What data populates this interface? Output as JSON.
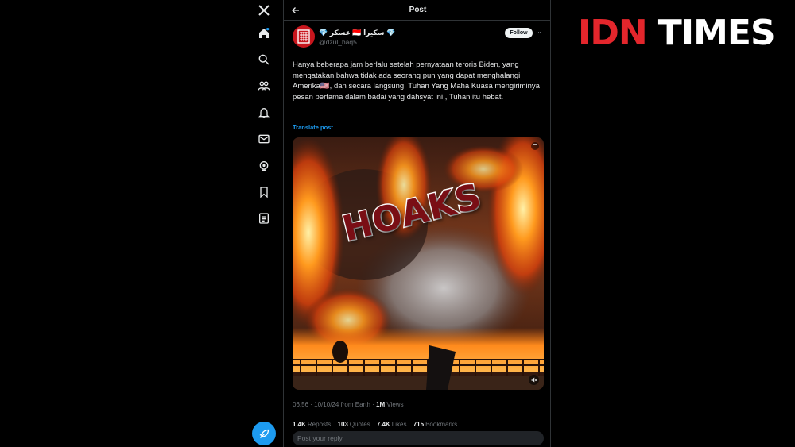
{
  "sidebar": {
    "icons": [
      "x-logo-icon",
      "home-icon",
      "search-icon",
      "communities-icon",
      "notifications-icon",
      "messages-icon",
      "grok-icon",
      "bookmarks-icon",
      "lists-icon"
    ],
    "post_button_icon": "feather-icon",
    "accent": "#1d9bf0"
  },
  "header": {
    "title": "Post",
    "back_icon": "arrow-left-icon"
  },
  "author": {
    "display_name": "💎 عسكر 🇮🇩 سكيرا 💎",
    "handle": "@dzul_haq5",
    "follow_label": "Follow",
    "more_label": "···"
  },
  "post": {
    "text": "Hanya beberapa jam berlalu setelah pernyataan teroris Biden, yang mengatakan bahwa tidak ada seorang pun yang dapat menghalangi Amerika🇺🇸, dan secara langsung, Tuhan Yang Maha Kuasa mengiriminya pesan pertama dalam badai yang dahsyat ini , Tuhan itu hebat.",
    "translate_label": "Translate post",
    "media_overlay_text": "HOAKS"
  },
  "meta": {
    "time": "06.56",
    "date": "10/10/24",
    "location": "from Earth",
    "views_value": "1M",
    "views_label": "Views",
    "sep": "·"
  },
  "stats": [
    {
      "value": "1.4K",
      "label": "Reposts"
    },
    {
      "value": "103",
      "label": "Quotes"
    },
    {
      "value": "7.4K",
      "label": "Likes"
    },
    {
      "value": "715",
      "label": "Bookmarks"
    }
  ],
  "reply": {
    "placeholder": "Post your reply"
  },
  "logo": {
    "part1": "IDN",
    "part2": "TIMES",
    "color1": "#e3262c",
    "color2": "#ffffff"
  }
}
